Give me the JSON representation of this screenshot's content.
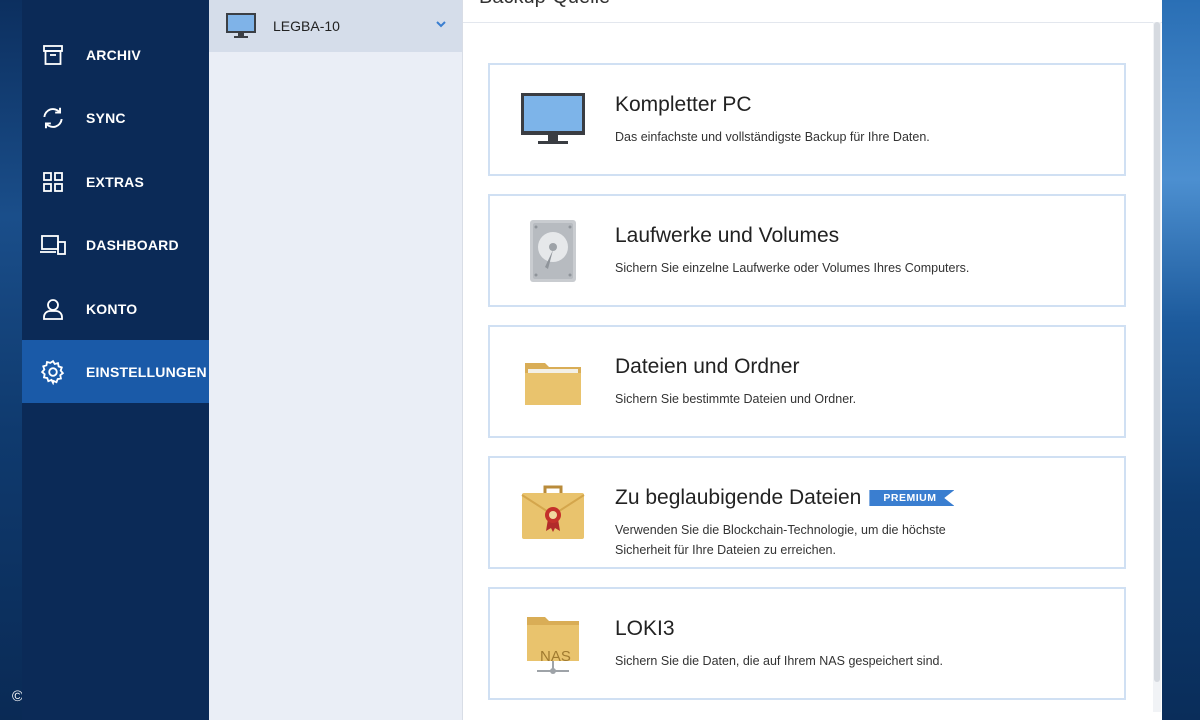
{
  "copyright": "©",
  "sidebar": {
    "items": [
      {
        "label": "ARCHIV",
        "icon": "archive-icon"
      },
      {
        "label": "SYNC",
        "icon": "sync-icon"
      },
      {
        "label": "EXTRAS",
        "icon": "grid-icon"
      },
      {
        "label": "DASHBOARD",
        "icon": "devices-icon"
      },
      {
        "label": "KONTO",
        "icon": "user-icon"
      },
      {
        "label": "EINSTELLUNGEN",
        "icon": "gear-icon",
        "active": true
      }
    ]
  },
  "source_panel": {
    "selected": {
      "label": "LEGBA-10",
      "icon": "monitor-icon"
    }
  },
  "main": {
    "title": "Backup-Quelle",
    "cards": [
      {
        "title": "Kompletter PC",
        "desc": "Das einfachste und vollständigste Backup für Ihre Daten.",
        "icon": "monitor-icon"
      },
      {
        "title": "Laufwerke und Volumes",
        "desc": "Sichern Sie einzelne Laufwerke oder Volumes Ihres Computers.",
        "icon": "hard-drive-icon"
      },
      {
        "title": "Dateien und Ordner",
        "desc": "Sichern Sie bestimmte Dateien und Ordner.",
        "icon": "folder-icon"
      },
      {
        "title": "Zu beglaubigende Dateien",
        "badge": "PREMIUM",
        "desc": "Verwenden Sie die Blockchain-Technologie, um die höchste Sicherheit für Ihre Dateien zu erreichen.",
        "icon": "briefcase-seal-icon"
      },
      {
        "title": "LOKI3",
        "desc": "Sichern Sie die Daten, die auf Ihrem NAS gespeichert sind.",
        "icon": "nas-folder-icon",
        "icon_text": "NAS"
      }
    ]
  },
  "colors": {
    "sidebar_bg": "#0b2a57",
    "sidebar_active": "#1a5aa8",
    "card_border": "#d0e0f3",
    "premium_badge": "#3a7ed0"
  }
}
